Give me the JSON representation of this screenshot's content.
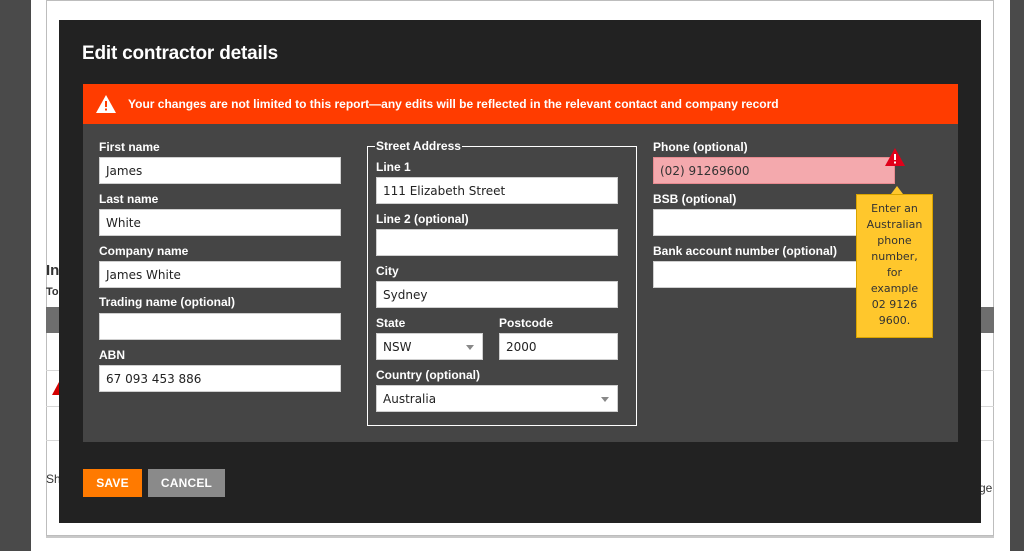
{
  "background": {
    "heading_fragment": "In",
    "sub_fragment": "To",
    "footer_left": "Sh",
    "footer_right": "ge"
  },
  "modal": {
    "title": "Edit contractor details",
    "alert": {
      "icon": "warning-triangle-icon",
      "text": "Your changes are not limited to this report—any edits will be reflected in the relevant contact and company record",
      "color": "#ff3c00"
    },
    "left_column": {
      "first_name": {
        "label": "First name",
        "value": "James"
      },
      "last_name": {
        "label": "Last name",
        "value": "White"
      },
      "company_name": {
        "label": "Company name",
        "value": "James White"
      },
      "trading_name": {
        "label": "Trading name (optional)",
        "value": ""
      },
      "abn": {
        "label": "ABN",
        "value": "67 093 453 886"
      }
    },
    "address": {
      "legend": "Street Address",
      "line1": {
        "label": "Line 1",
        "value": "111 Elizabeth Street"
      },
      "line2": {
        "label": "Line 2 (optional)",
        "value": ""
      },
      "city": {
        "label": "City",
        "value": "Sydney"
      },
      "state": {
        "label": "State",
        "value": "NSW"
      },
      "postcode": {
        "label": "Postcode",
        "value": "2000"
      },
      "country": {
        "label": "Country (optional)",
        "value": "Australia"
      }
    },
    "right_column": {
      "phone": {
        "label": "Phone (optional)",
        "value": "(02) 91269600",
        "error_color": "#f4a9ad"
      },
      "bsb": {
        "label": "BSB (optional)",
        "value": ""
      },
      "bank_account": {
        "label": "Bank account number (optional)",
        "value": ""
      }
    },
    "tooltip": {
      "lines": [
        "Enter an",
        "Australian",
        "phone",
        "number,",
        "for",
        "example",
        "02 9126",
        "9600."
      ],
      "color": "#ffc72c"
    },
    "buttons": {
      "save": "SAVE",
      "cancel": "CANCEL",
      "save_color": "#ff7a00",
      "cancel_color": "#8a8a8a"
    }
  }
}
